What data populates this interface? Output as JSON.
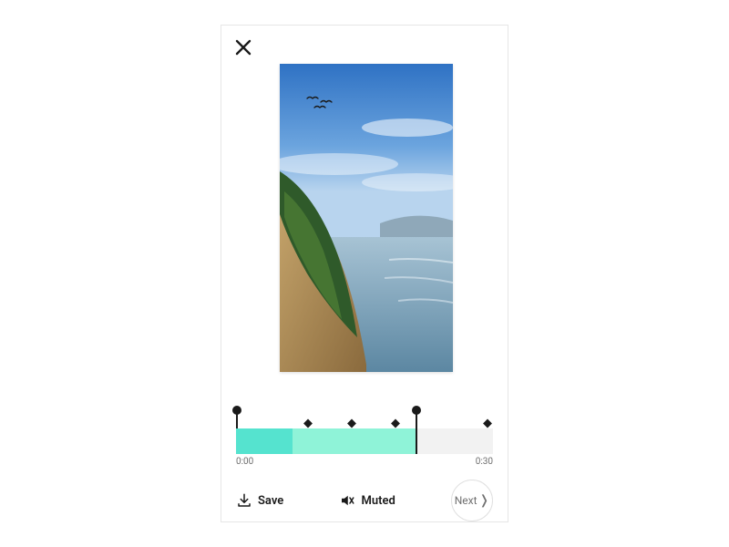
{
  "timeline": {
    "start_label": "0:00",
    "end_label": "0:30",
    "trim_start_pct": 0,
    "trim_end_pct": 70,
    "playhead_pct": 70
  },
  "toolbar": {
    "save_label": "Save",
    "mute_label": "Muted",
    "next_label": "Next"
  }
}
